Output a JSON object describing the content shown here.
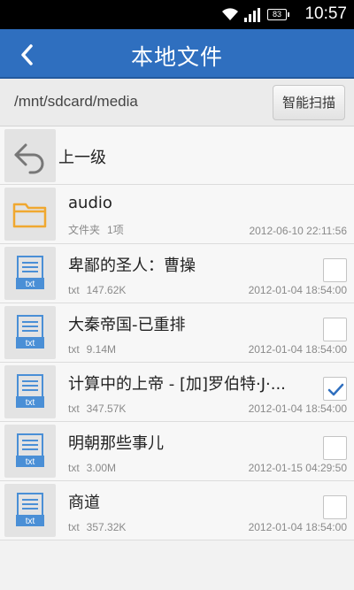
{
  "status_bar": {
    "time": "10:57",
    "battery": "83",
    "icons": [
      "wifi-icon",
      "signal-icon",
      "battery-icon"
    ]
  },
  "title_bar": {
    "title": "本地文件",
    "back_icon": "back-arrow-icon"
  },
  "path_bar": {
    "path": "/mnt/sdcard/media",
    "scan_label": "智能扫描"
  },
  "up_row": {
    "label": "上一级",
    "icon": "up-level-icon"
  },
  "files": [
    {
      "name": "audio",
      "type": "文件夹",
      "sub": "1项",
      "date": "2012-06-10 22:11:56",
      "icon": "folder-icon",
      "checkbox": false,
      "checked": false
    },
    {
      "name": "卑鄙的圣人：曹操",
      "type": "txt",
      "sub": "147.62K",
      "date": "2012-01-04 18:54:00",
      "icon": "txt-file-icon",
      "checkbox": true,
      "checked": false
    },
    {
      "name": "大秦帝国-已重排",
      "type": "txt",
      "sub": "9.14M",
      "date": "2012-01-04 18:54:00",
      "icon": "txt-file-icon",
      "checkbox": true,
      "checked": false
    },
    {
      "name": "计算中的上帝 - [加]罗伯特·J·...",
      "type": "txt",
      "sub": "347.57K",
      "date": "2012-01-04 18:54:00",
      "icon": "txt-file-icon",
      "checkbox": true,
      "checked": true
    },
    {
      "name": "明朝那些事儿",
      "type": "txt",
      "sub": "3.00M",
      "date": "2012-01-15 04:29:50",
      "icon": "txt-file-icon",
      "checkbox": true,
      "checked": false
    },
    {
      "name": "商道",
      "type": "txt",
      "sub": "357.32K",
      "date": "2012-01-04 18:54:00",
      "icon": "txt-file-icon",
      "checkbox": true,
      "checked": false
    }
  ],
  "colors": {
    "title_bar": "#2f6fbf",
    "folder": "#f0a830",
    "txt_icon": "#4a8fd6",
    "check": "#2f6fbf"
  }
}
